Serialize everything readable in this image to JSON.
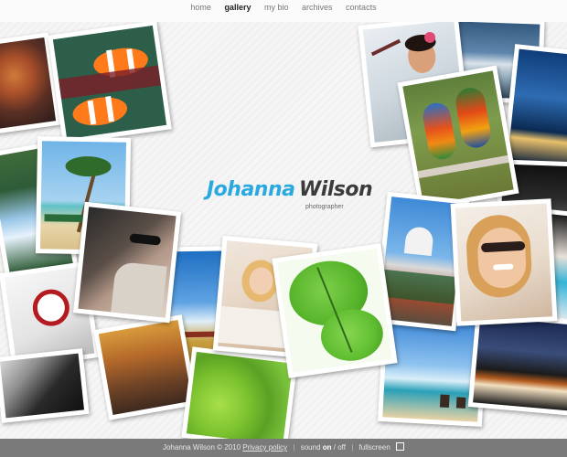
{
  "nav": {
    "items": [
      {
        "label": "home",
        "active": false
      },
      {
        "label": "gallery",
        "active": true
      },
      {
        "label": "my bio",
        "active": false
      },
      {
        "label": "archives",
        "active": false
      },
      {
        "label": "contacts",
        "active": false
      }
    ]
  },
  "logo": {
    "first_name": "Johanna",
    "last_name": "Wilson",
    "subtitle": "photographer"
  },
  "photos": [
    {
      "subject": "coral reef"
    },
    {
      "subject": "clownfish"
    },
    {
      "subject": "waterfall"
    },
    {
      "subject": "palm tree beach"
    },
    {
      "subject": "woman with sunglasses"
    },
    {
      "subject": "white interior"
    },
    {
      "subject": "woman in black dress"
    },
    {
      "subject": "woman with flowers"
    },
    {
      "subject": "snowy mountains"
    },
    {
      "subject": "parrots"
    },
    {
      "subject": "night harbor"
    },
    {
      "subject": "dark city"
    },
    {
      "subject": "woman smiling with sunglasses"
    },
    {
      "subject": "mosque domes"
    },
    {
      "subject": "blue sky with clouds"
    },
    {
      "subject": "blonde woman"
    },
    {
      "subject": "green leaf"
    },
    {
      "subject": "golden bridge"
    },
    {
      "subject": "green leaves"
    },
    {
      "subject": "beach people"
    },
    {
      "subject": "city night traffic"
    },
    {
      "subject": "turquoise portrait"
    }
  ],
  "footer": {
    "copyright": "Johanna Wilson © 2010",
    "privacy": "Privacy policy",
    "sound_label": "sound",
    "sound_on": "on",
    "sound_off": "off",
    "fullscreen": "fullscreen"
  },
  "colors": {
    "accent": "#2aa9e0",
    "dark_text": "#3b3b3b",
    "footer_bg": "#7a7a7a"
  }
}
